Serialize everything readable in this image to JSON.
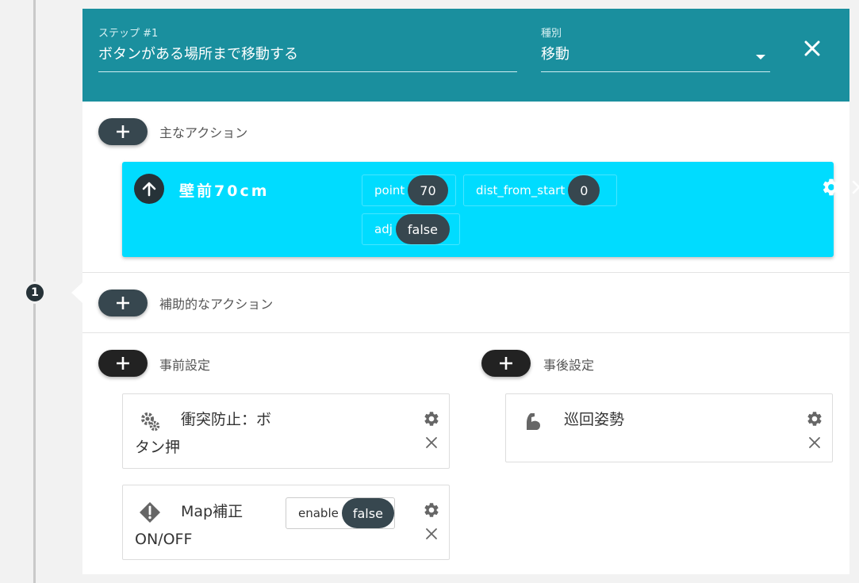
{
  "step": {
    "number": "1",
    "header": {
      "title_label": "ステップ #1",
      "title_value": "ボタンがある場所まで移動する",
      "type_label": "種別",
      "type_value": "移動"
    }
  },
  "main_actions": {
    "label": "主なアクション",
    "items": [
      {
        "icon": "arrow-up-icon",
        "title": "壁前70cm",
        "params": [
          {
            "name": "point",
            "value": "70"
          },
          {
            "name": "dist_from_start",
            "value": "0"
          },
          {
            "name": "adj",
            "value": "false"
          }
        ]
      }
    ]
  },
  "sub_actions": {
    "label": "補助的なアクション"
  },
  "pre_settings": {
    "label": "事前設定",
    "items": [
      {
        "icon": "gears-icon",
        "title_line1": "衝突防止：ボ",
        "title_line2": "タン押"
      },
      {
        "icon": "warning-diamond-icon",
        "title_line1": "Map補正",
        "title_line2": "ON/OFF",
        "param": {
          "name": "enable",
          "value": "false"
        }
      }
    ]
  },
  "post_settings": {
    "label": "事後設定",
    "items": [
      {
        "icon": "arm-flex-icon",
        "title_line1": "巡回姿勢"
      }
    ]
  },
  "colors": {
    "header_bg": "#1a8f9e",
    "main_action_bg": "#00dcff",
    "chip_bg": "#37474f"
  }
}
